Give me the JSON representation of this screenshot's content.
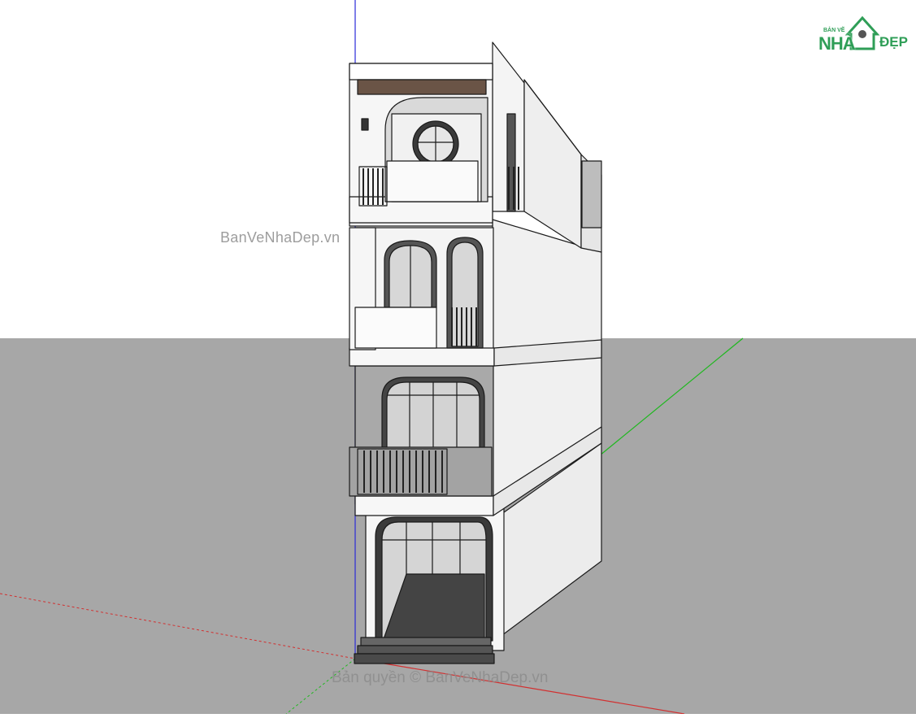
{
  "canvas": {
    "sky_color": "#ffffff",
    "ground_color": "#a7a7a7",
    "axis_red": "#d23030",
    "axis_green": "#1fb81f",
    "axis_blue": "#2a2ad8"
  },
  "watermarks": {
    "middle": "BanVeNhaDep.vn",
    "bottom": "Bản quyền © BanVeNhaDep.vn"
  },
  "logo": {
    "top_text": "BẢN VẼ",
    "main_text": "NHÀ",
    "side_text": "ĐẸP",
    "color": "#2f9e57"
  },
  "model": {
    "subject": "townhouse-3d-model",
    "floors": 4,
    "wall_color": "#f2f2f2",
    "concrete_color": "#a9a9a9",
    "frame_color": "#3a3a3a"
  }
}
